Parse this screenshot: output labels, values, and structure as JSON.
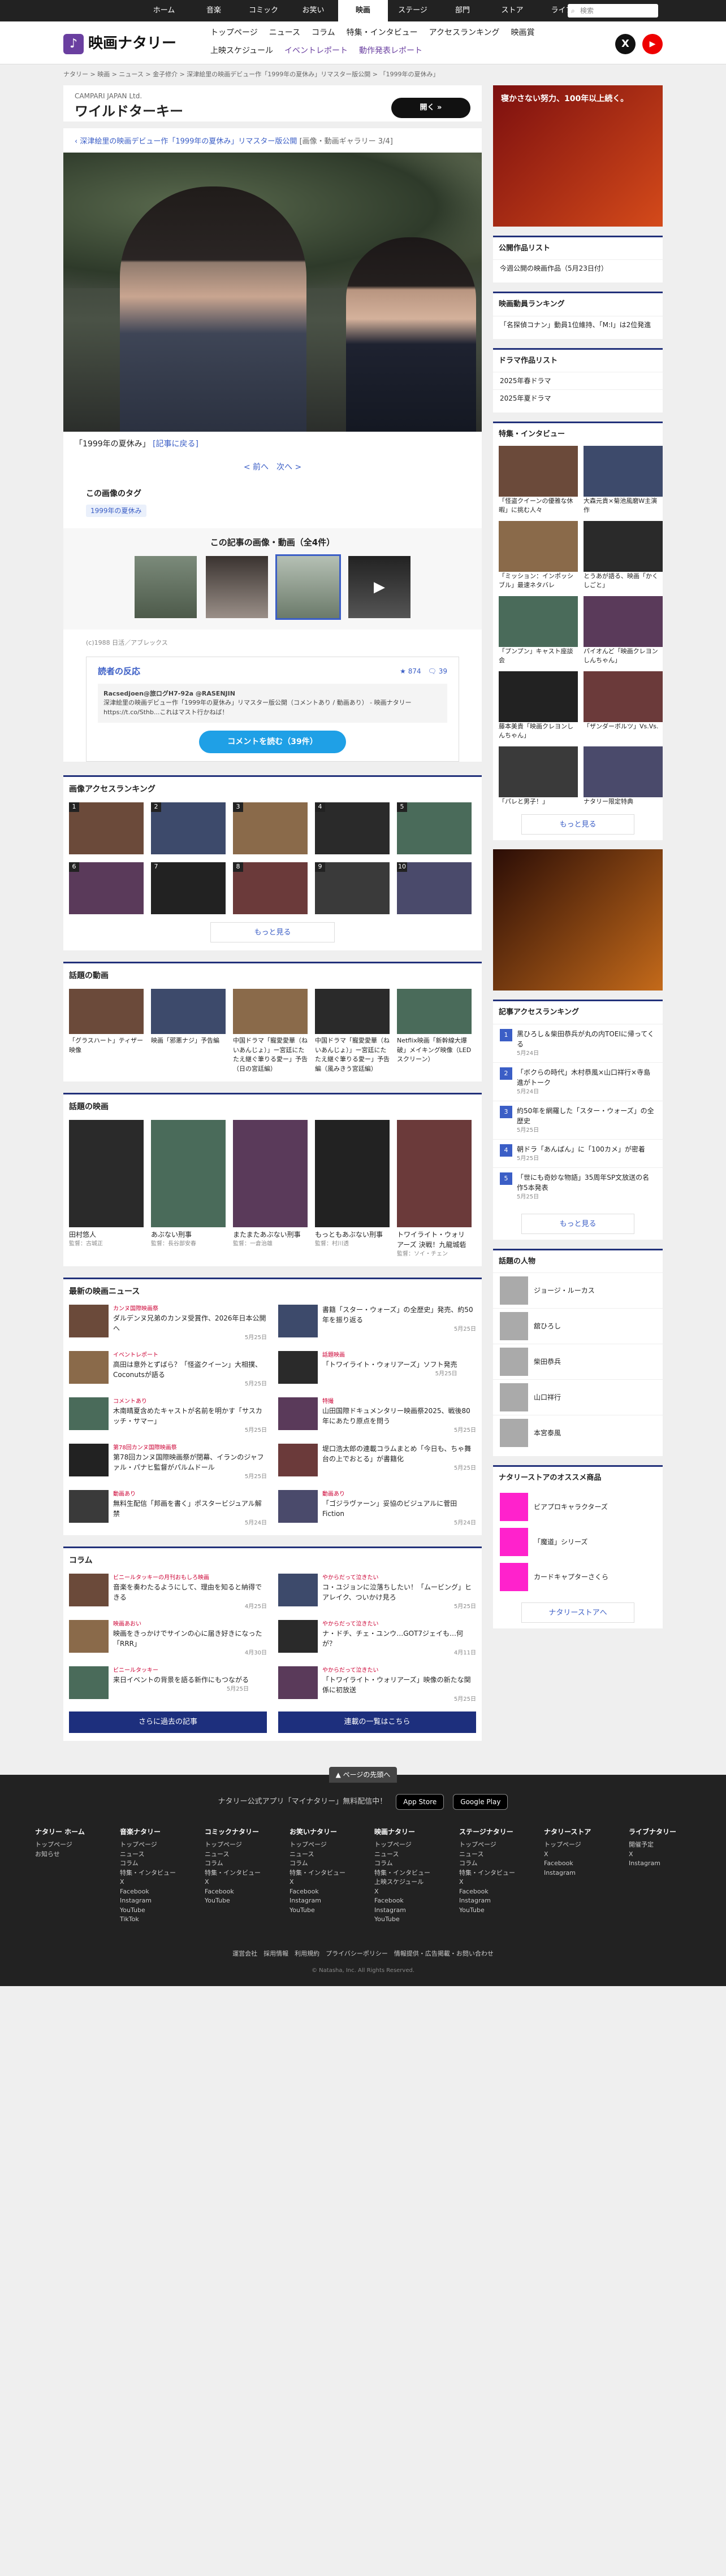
{
  "topnav": {
    "items": [
      "ホーム",
      "音楽",
      "コミック",
      "お笑い",
      "映画",
      "ステージ",
      "部門",
      "ストア",
      "ライブ"
    ],
    "active": 4,
    "search_placeholder": "検索"
  },
  "header": {
    "logo": "映画ナタリー",
    "nav1": [
      "トップページ",
      "ニュース",
      "コラム",
      "特集・インタビュー",
      "アクセスランキング",
      "映画賞"
    ],
    "nav2": [
      "上映スケジュール",
      "イベントレポート",
      "動作発表レポート"
    ]
  },
  "breadcrumb": "ナタリー > 映画 > ニュース > 金子修介 > 深津絵里の映画デビュー作「1999年の夏休み」リマスター版公開 > 「1999年の夏休み」",
  "ad_top": {
    "company": "CAMPARI JAPAN Ltd.",
    "name": "ワイルドターキー",
    "button": "開く »"
  },
  "article": {
    "title": "深津絵里の映画デビュー作「1999年の夏休み」リマスター版公開",
    "gallery_note": "[画像・動画ギャラリー 3/4]",
    "caption": "「1999年の夏休み」",
    "back_link": "[記事に戻る]",
    "prev": "< 前へ",
    "next": "次へ >"
  },
  "tags": {
    "title": "この画像のタグ",
    "items": [
      "1999年の夏休み"
    ]
  },
  "gallery": {
    "title": "この記事の画像・動画（全4件）"
  },
  "credit": "(c)1988 日活／アブレックス",
  "reaction": {
    "title": "読者の反応",
    "stars": "★ 874",
    "comments": "🗨 39",
    "user": "Racsedjoen@旅ログH7-92a @RASENJIN",
    "tweet": "深津絵里の映画デビュー作「1999年の夏休み」リマスター版公開（コメントあり / 動画あり） - 映画ナタリー https://t.co/Sthb...これはマスト行かねば！",
    "button": "コメントを読む（39件）"
  },
  "ranking": {
    "title": "画像アクセスランキング",
    "more": "もっと見る",
    "items": [
      "1",
      "2",
      "3",
      "4",
      "5",
      "6",
      "7",
      "8",
      "9",
      "10"
    ]
  },
  "videos": {
    "title": "話題の動画",
    "items": [
      "「グラスハート」ティザー映像",
      "映画「邪悪ナジ」予告編",
      "中国ドラマ「寵愛愛華（ねいあんじょ）」ー宮廷にたたえ継ぐ筆りる愛ー」予告（日の宮廷編）",
      "中国ドラマ「寵愛愛華（ねいあんじょ）」ー宮廷にたたえ継ぐ筆りる愛ー」予告編（風みきう宮廷編）",
      "Netflix映画「新幹線大爆破」メイキング映像（LEDスクリーン）"
    ]
  },
  "films": {
    "title": "話題の映画",
    "items": [
      {
        "t": "田村悠人",
        "s": "監督：古城正"
      },
      {
        "t": "あぶない刑事",
        "s": "監督：長谷部安春"
      },
      {
        "t": "またまたあぶない刑事",
        "s": "監督：一倉治雄"
      },
      {
        "t": "もっともあぶない刑事",
        "s": "監督：村川透"
      },
      {
        "t": "トワイライト・ウォリアーズ 決戦！九龍城砦",
        "s": "監督：ソイ・チェン"
      }
    ]
  },
  "news": {
    "title": "最新の映画ニュース",
    "items": [
      {
        "l": "カンヌ国際映画祭",
        "t": "ダルデンヌ兄弟のカンヌ受賞作、2026年日本公開へ",
        "d": "5月25日"
      },
      {
        "l": "",
        "t": "書籍「スター・ウォーズ」の全歴史」発売、約50年を振り返る",
        "d": "5月25日"
      },
      {
        "l": "イベントレポート",
        "t": "高田は意外とずばら？「怪盗クイーン」大相撲、Coconutsが語る",
        "d": "5月25日"
      },
      {
        "l": "話題映画",
        "t": "「トワイライト・ウォリアーズ」ソフト発売",
        "d": "5月25日"
      },
      {
        "l": "コメントあり",
        "t": "木南晴夏含めたキャストが名前を明かす「サスカッチ・サマー」",
        "d": "5月25日"
      },
      {
        "l": "特撮",
        "t": "山田国際ドキュメンタリー映画祭2025、戦後80年にあたり原点を問う",
        "d": "5月25日"
      },
      {
        "l": "第78回カンヌ国際映画祭",
        "t": "第78回カンヌ国際映画祭が閉幕、イランのジャファル・パナヒ監督がパルムドール",
        "d": "5月25日"
      },
      {
        "l": "",
        "t": "堤口浩太郎の連載コラムまとめ「今日も、ちゃ舞台の上でおとる」が書籍化",
        "d": "5月25日"
      },
      {
        "l": "動画あり",
        "t": "無料生配信「邦画を書く」ポスタービジュアル解禁",
        "d": "5月24日"
      },
      {
        "l": "動画あり",
        "t": "「ゴジラヴァーン」妥協のビジュアルに菅田Fiction",
        "d": "5月24日"
      }
    ]
  },
  "column": {
    "title": "コラム",
    "items": [
      {
        "l": "ビニールタッキーの月刊おもしろ映画",
        "t": "音楽を奏わたるようにして、理由を知ると納得できる",
        "d": "4月25日"
      },
      {
        "l": "やからだって泣きたい",
        "t": "コ・ユジョンに泣落ちしたい！「ムービング」ヒアレイク、ついかけ見ろ",
        "d": "5月25日"
      },
      {
        "l": "映画あおい",
        "t": "映画をきっかけでサインの心に届き好きになった「RRR」",
        "d": "4月30日"
      },
      {
        "l": "やからだって泣きたい",
        "t": "ナ・ドチ、チェ・ユンウ…GOT7ジェイも…何が？",
        "d": "4月11日"
      },
      {
        "l": "ビニールタッキー",
        "t": "来日イベントの背景を語る新作にもつながる",
        "d": "5月25日"
      },
      {
        "l": "やからだって泣きたい",
        "t": "「トワイライト・ウォリアーズ」映像の新たな関係に初放送",
        "d": "5月25日"
      }
    ],
    "more1": "さらに過去の記事",
    "more2": "連載の一覧はこちら"
  },
  "side": {
    "ad_text": "寝かさない努力、100年以上続く。",
    "now": {
      "title": "公開作品リスト",
      "items": [
        "今週公開の映画作品（5月23日付）"
      ]
    },
    "ranking": {
      "title": "映画動員ランキング",
      "items": [
        "「名探偵コナン」動員1位維持、「M:I」は2位発進"
      ]
    },
    "drama": {
      "title": "ドラマ作品リスト",
      "items": [
        "2025年春ドラマ",
        "2025年夏ドラマ"
      ]
    },
    "feature": {
      "title": "特集・インタビュー",
      "items": [
        "「怪盗クイーンの優雅な休暇」に挑む人々",
        "大森元貴×菊池風磨W主演作",
        "「ミッション：インポッシブル」最速ネタバレ",
        "とうあが語る、映画「かくしごと」",
        "「プンプン」キャスト座談会",
        "パイオんど「映画クレヨンしんちゃん」",
        "藤本美貴「映画クレヨンしんちゃん」",
        "「ザンダーボルツ」Vs.Vs.",
        "「パレと男子！」",
        "ナタリー限定特典"
      ],
      "more": "もっと見る"
    },
    "access": {
      "title": "記事アクセスランキング",
      "items": [
        {
          "n": "1",
          "t": "黒ひろし＆柴田恭兵が丸の内TOEIに帰ってくる",
          "d": "5月24日"
        },
        {
          "n": "2",
          "t": "「ボクらの時代」木村恭風×山口祥行×寺島進がトーク",
          "d": "5月24日"
        },
        {
          "n": "3",
          "t": "約50年を網羅した「スター・ウォーズ」の全歴史",
          "d": "5月25日"
        },
        {
          "n": "4",
          "t": "朝ドラ「あんぱん」に「100カメ」が密着",
          "d": "5月25日"
        },
        {
          "n": "5",
          "t": "「世にも奇妙な物語」35周年SP文放送の名作5本発表",
          "d": "5月25日"
        }
      ],
      "more": "もっと見る"
    },
    "people": {
      "title": "話題の人物",
      "items": [
        "ジョージ・ルーカス",
        "舘ひろし",
        "柴田恭兵",
        "山口祥行",
        "本宮泰風"
      ]
    },
    "store": {
      "title": "ナタリーストアのオススメ商品",
      "items": [
        "ビアプロキャラクターズ",
        "「魔道」シリーズ",
        "カードキャプターさくら"
      ],
      "more": "ナタリーストアへ"
    }
  },
  "footer": {
    "pagetop": "▲ ページの先頭へ",
    "app_text": "ナタリー公式アプリ「マイナタリー」無料配信中！",
    "appstore": "App Store",
    "googleplay": "Google Play",
    "cols": [
      {
        "h": "ナタリー ホーム",
        "i": [
          "トップページ",
          "お知らせ"
        ]
      },
      {
        "h": "音楽ナタリー",
        "i": [
          "トップページ",
          "ニュース",
          "コラム",
          "特集・インタビュー",
          "X",
          "Facebook",
          "Instagram",
          "YouTube",
          "TikTok"
        ]
      },
      {
        "h": "コミックナタリー",
        "i": [
          "トップページ",
          "ニュース",
          "コラム",
          "特集・インタビュー",
          "X",
          "Facebook",
          "YouTube"
        ]
      },
      {
        "h": "お笑いナタリー",
        "i": [
          "トップページ",
          "ニュース",
          "コラム",
          "特集・インタビュー",
          "X",
          "Facebook",
          "Instagram",
          "YouTube"
        ]
      },
      {
        "h": "映画ナタリー",
        "i": [
          "トップページ",
          "ニュース",
          "コラム",
          "特集・インタビュー",
          "上映スケジュール",
          "X",
          "Facebook",
          "Instagram",
          "YouTube"
        ]
      },
      {
        "h": "ステージナタリー",
        "i": [
          "トップページ",
          "ニュース",
          "コラム",
          "特集・インタビュー",
          "X",
          "Facebook",
          "Instagram",
          "YouTube"
        ]
      },
      {
        "h": "ナタリーストア",
        "i": [
          "トップページ",
          "X",
          "Facebook",
          "Instagram"
        ]
      },
      {
        "h": "ライブナタリー",
        "i": [
          "開催予定",
          "X",
          "Instagram"
        ]
      }
    ],
    "links": "運営会社　採用情報　利用規約　プライバシーポリシー　情報提供・広告掲載・お問い合わせ",
    "copy": "© Natasha, Inc. All Rights Reserved."
  }
}
